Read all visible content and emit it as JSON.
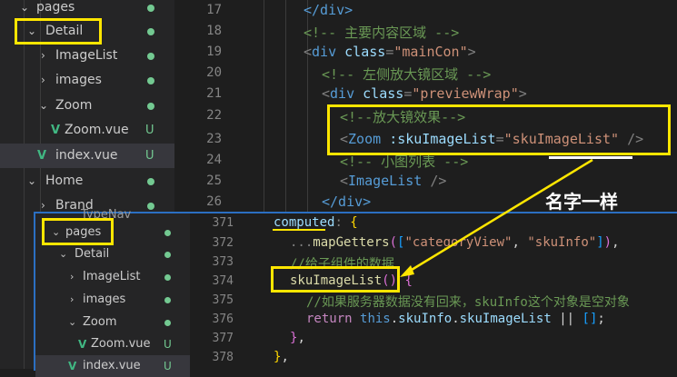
{
  "top_sidebar": {
    "rows": [
      {
        "chev": "⌄",
        "label": "pages",
        "status": "dot"
      },
      {
        "chev": "⌄",
        "label": "Detail",
        "status": "dot",
        "highlighted": true
      },
      {
        "chev": "›",
        "label": "ImageList",
        "status": "dot"
      },
      {
        "chev": "›",
        "label": "images",
        "status": "dot"
      },
      {
        "chev": "⌄",
        "label": "Zoom",
        "status": "dot"
      },
      {
        "chev": "",
        "label": "Zoom.vue",
        "status": "U",
        "vue": true
      },
      {
        "chev": "",
        "label": "index.vue",
        "status": "U",
        "vue": true,
        "selected": true
      },
      {
        "chev": "⌄",
        "label": "Home",
        "status": "dot"
      },
      {
        "chev": "›",
        "label": "Brand",
        "status": "dot"
      }
    ]
  },
  "top_editor": {
    "line_numbers": [
      "17",
      "18",
      "19",
      "20",
      "21",
      "22",
      "23",
      "24",
      "25",
      "26"
    ]
  },
  "bottom_sidebar": {
    "rows": [
      {
        "label": "TypeNav"
      },
      {
        "chev": "⌄",
        "label": "pages",
        "status": "dot",
        "highlighted": true
      },
      {
        "chev": "⌄",
        "label": "Detail",
        "status": "dot"
      },
      {
        "chev": "›",
        "label": "ImageList",
        "status": "dot"
      },
      {
        "chev": "›",
        "label": "images",
        "status": "dot"
      },
      {
        "chev": "⌄",
        "label": "Zoom",
        "status": "dot"
      },
      {
        "chev": "",
        "label": "Zoom.vue",
        "status": "U",
        "vue": true
      },
      {
        "chev": "",
        "label": "index.vue",
        "status": "U",
        "vue": true
      }
    ]
  },
  "bottom_editor": {
    "line_numbers": [
      "371",
      "372",
      "373",
      "374",
      "375",
      "376",
      "377",
      "378"
    ]
  },
  "annotation": {
    "text": "名字一样"
  },
  "code": {
    "l17": "</div>",
    "l18": "<!-- 主要内容区域 -->",
    "l19_tag": "div",
    "l19_attr": "class",
    "l19_val": "\"mainCon\"",
    "l20": "<!-- 左侧放大镜区域 -->",
    "l21_tag": "div",
    "l21_attr": "class",
    "l21_val": "\"previewWrap\"",
    "l22": "<!--放大镜效果-->",
    "l23_tag": "Zoom",
    "l23_attr": ":skuImageList",
    "l23_val": "\"skuImageList\"",
    "l24": "<!-- 小图列表 -->",
    "l25_tag": "ImageList",
    "l26": "</div>",
    "b371_name": "computed",
    "b372_fn": "mapGetters",
    "b372_s1": "\"categoryView\"",
    "b372_s2": "\"skuInfo\"",
    "b373": "//给子组件的数据",
    "b374_fn": "skuImageList",
    "b375": "//如果服务器数据没有回来，skuInfo这个对象是空对象",
    "b376_kw": "return",
    "b376_this": "this",
    "b376_p1": "skuInfo",
    "b376_p2": "skuImageList"
  }
}
